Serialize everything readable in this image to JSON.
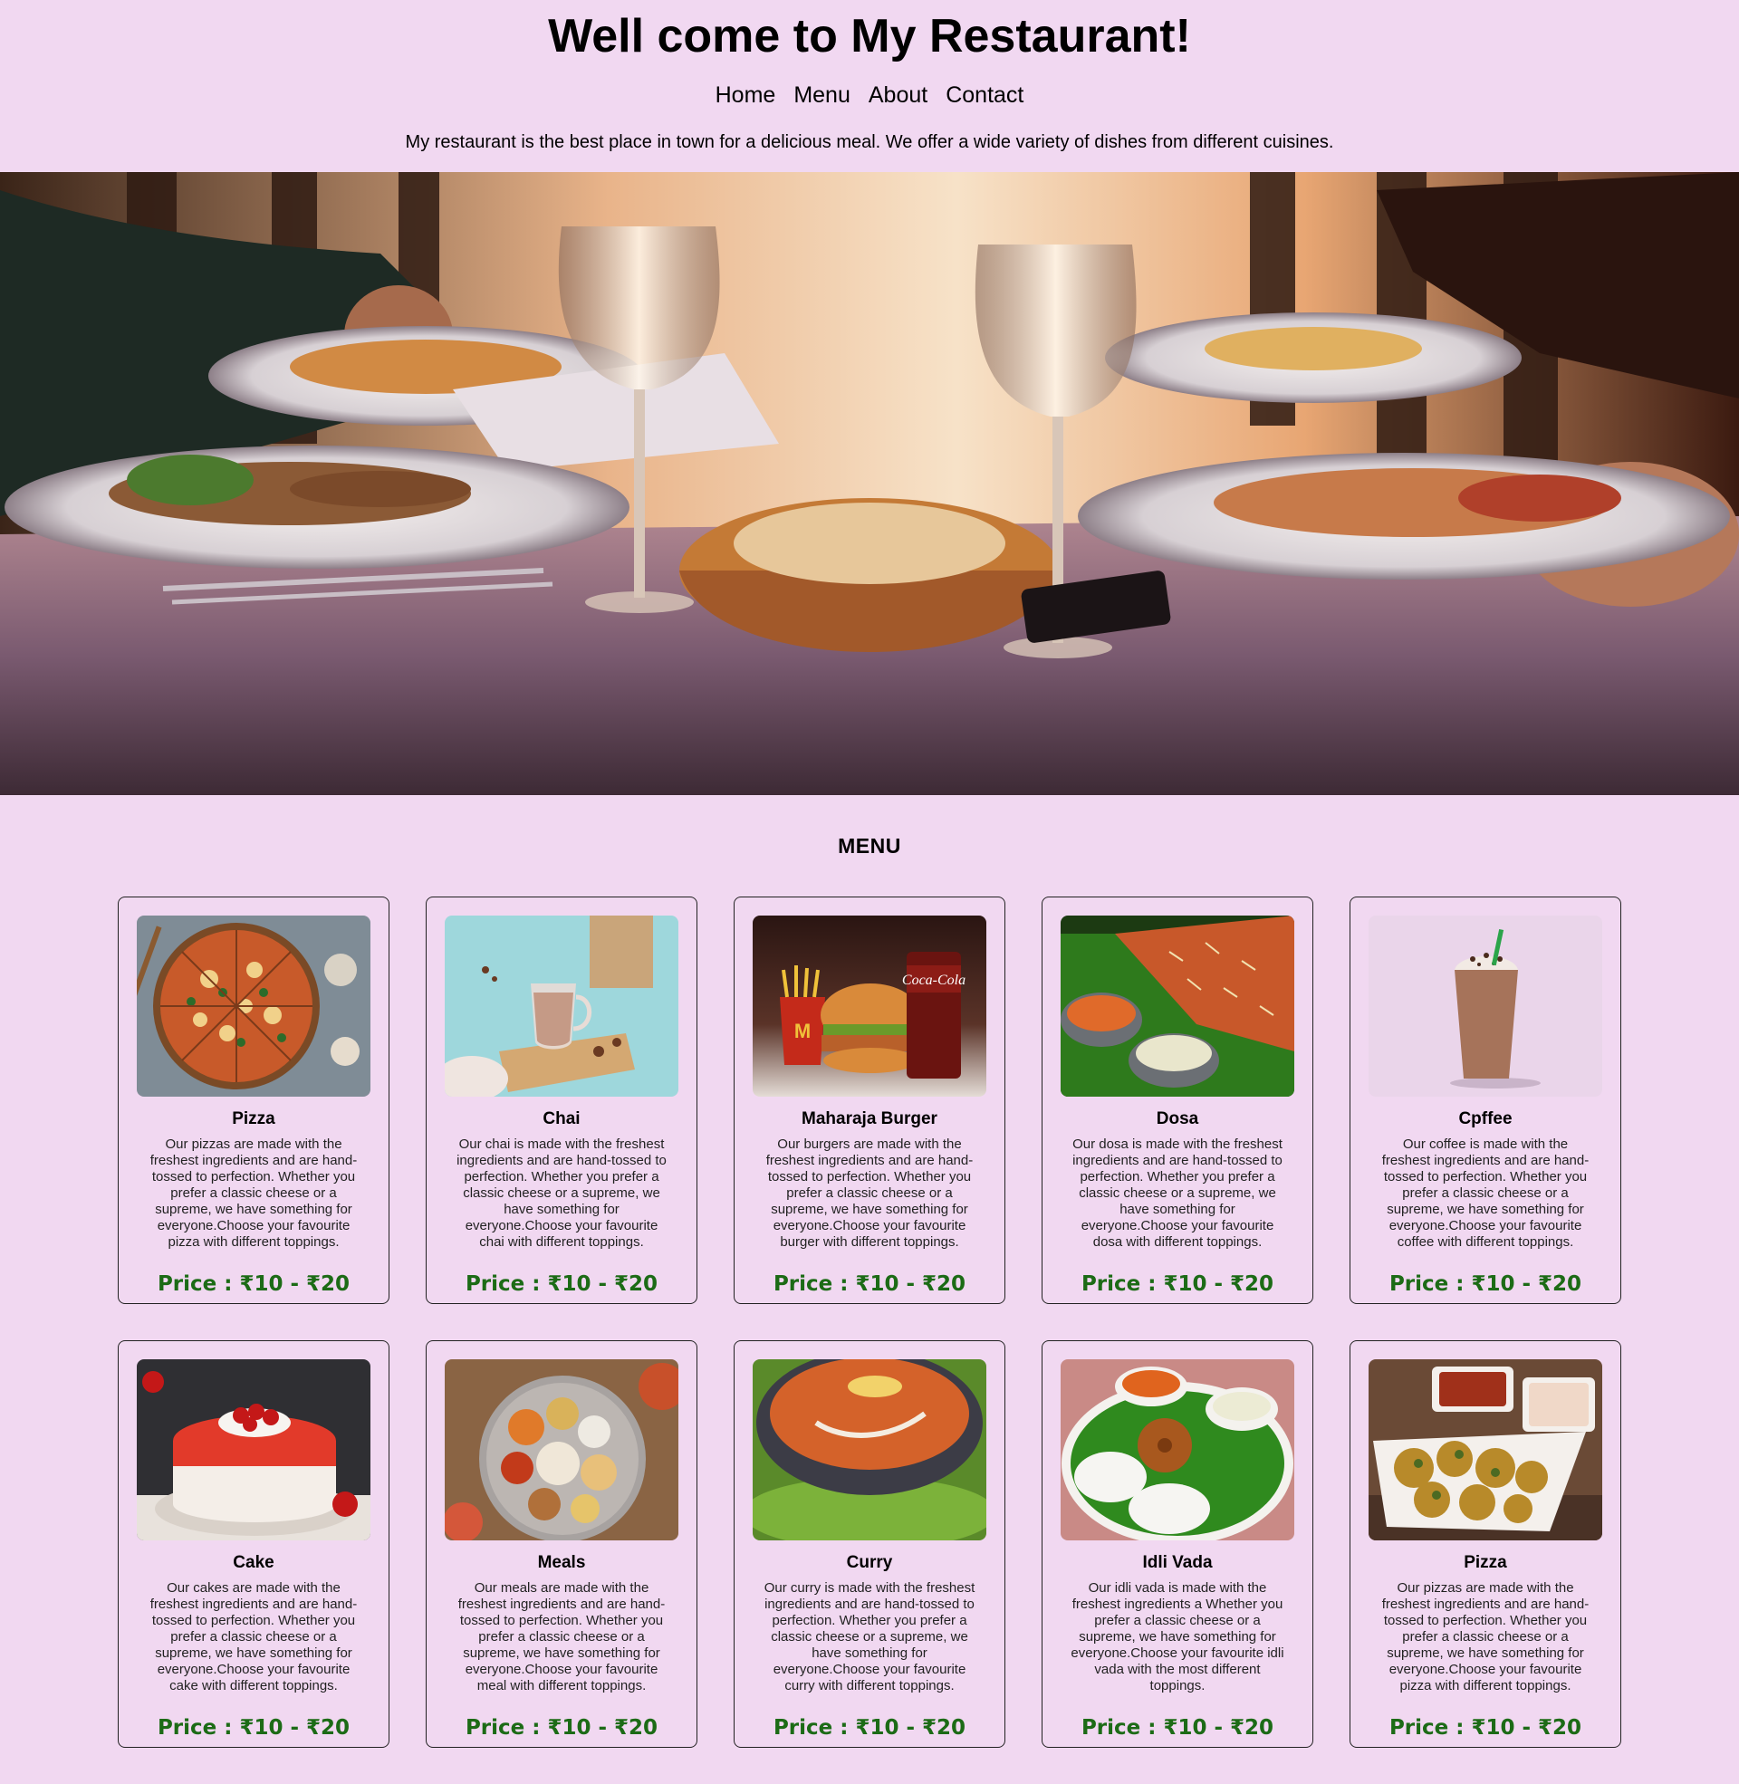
{
  "header": {
    "title": "Well come to My Restaurant!",
    "nav": [
      "Home",
      "Menu",
      "About",
      "Contact"
    ],
    "intro": "My restaurant is the best place in town for a delicious meal. We offer a wide variety of dishes from different cuisines."
  },
  "hero": {
    "image": "restaurant-table-photo"
  },
  "menu": {
    "heading": "MENU",
    "items": [
      {
        "name": "Pizza",
        "description": "Our pizzas are made with the freshest ingredients and are hand-tossed to perfection. Whether you prefer a classic cheese or a supreme, we have something for everyone.Choose your favourite pizza with different toppings.",
        "price": "Price : ₹10 - ₹20"
      },
      {
        "name": "Chai",
        "description": "Our chai is made with the freshest ingredients and are hand-tossed to perfection. Whether you prefer a classic cheese or a supreme, we have something for everyone.Choose your favourite chai with different toppings.",
        "price": "Price : ₹10 - ₹20"
      },
      {
        "name": "Maharaja Burger",
        "description": "Our burgers are made with the freshest ingredients and are hand-tossed to perfection. Whether you prefer a classic cheese or a supreme, we have something for everyone.Choose your favourite burger with different toppings.",
        "price": "Price : ₹10 - ₹20"
      },
      {
        "name": "Dosa",
        "description": "Our dosa is made with the freshest ingredients and are hand-tossed to perfection. Whether you prefer a classic cheese or a supreme, we have something for everyone.Choose your favourite dosa with different toppings.",
        "price": "Price : ₹10 - ₹20"
      },
      {
        "name": "Cpffee",
        "description": "Our coffee is made with the freshest ingredients and are hand-tossed to perfection. Whether you prefer a classic cheese or a supreme, we have something for everyone.Choose your favourite coffee with different toppings.",
        "price": "Price : ₹10 - ₹20"
      },
      {
        "name": "Cake",
        "description": "Our cakes are made with the freshest ingredients and are hand-tossed to perfection. Whether you prefer a classic cheese or a supreme, we have something for everyone.Choose your favourite cake with different toppings.",
        "price": "Price : ₹10 - ₹20"
      },
      {
        "name": "Meals",
        "description": "Our meals are made with the freshest ingredients and are hand-tossed to perfection. Whether you prefer a classic cheese or a supreme, we have something for everyone.Choose your favourite meal with different toppings.",
        "price": "Price : ₹10 - ₹20"
      },
      {
        "name": "Curry",
        "description": "Our curry is made with the freshest ingredients and are hand-tossed to perfection. Whether you prefer a classic cheese or a supreme, we have something for everyone.Choose your favourite curry with different toppings.",
        "price": "Price : ₹10 - ₹20"
      },
      {
        "name": "Idli Vada",
        "description": "Our idli vada is made with the freshest ingredients a Whether you prefer a classic cheese or a supreme, we have something for everyone.Choose your favourite idli vada with the most different toppings.",
        "price": "Price : ₹10 - ₹20"
      },
      {
        "name": "Pizza",
        "description": "Our pizzas are made with the freshest ingredients and are hand-tossed to perfection. Whether you prefer a classic cheese or a supreme, we have something for everyone.Choose your favourite pizza with different toppings.",
        "price": "Price : ₹10 - ₹20"
      }
    ]
  },
  "colors": {
    "background": "#f1d8f1",
    "price": "#1c6b16",
    "border": "#222222"
  }
}
